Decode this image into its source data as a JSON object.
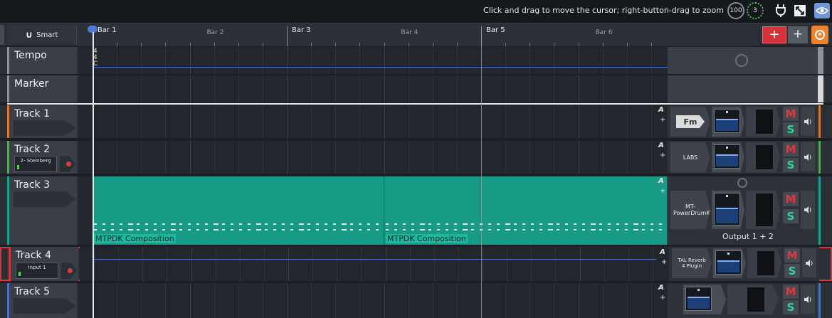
{
  "status": {
    "hint": "Click and drag to move the cursor; right-button-drag to zoom",
    "cpu_meter": "100",
    "dynamic_meter": "3",
    "icons": [
      "plug-icon",
      "fullscreen-icon",
      "eye-icon"
    ]
  },
  "toolbar": {
    "snap_label": "Smart",
    "add_track_label": "+",
    "add_label": "+"
  },
  "ruler": {
    "bars": [
      {
        "label": "Bar 1",
        "major": true
      },
      {
        "label": "Bar 2",
        "major": false
      },
      {
        "label": "Bar 3",
        "major": true
      },
      {
        "label": "Bar 4",
        "major": false
      },
      {
        "label": "Bar 5",
        "major": true
      },
      {
        "label": "Bar 6",
        "major": false
      }
    ]
  },
  "tempo": {
    "name": "Tempo",
    "time_sig_top": "4",
    "time_sig_bottom": "4",
    "key": "C"
  },
  "marker": {
    "name": "Marker"
  },
  "tracks": [
    {
      "name": "Track 1",
      "input": "",
      "plugin": "Fm",
      "accent": "#d9772e"
    },
    {
      "name": "Track 2",
      "input": "2- Steinberg",
      "plugin": "LABS",
      "accent": "#5aa55a"
    },
    {
      "name": "Track 3",
      "input": "",
      "plugin": "MT-PowerDrumKit",
      "accent": "#17a38c",
      "clips": [
        "MTPDK Composition",
        "MTPDK Composition"
      ],
      "output": "Output 1 + 2"
    },
    {
      "name": "Track 4",
      "input": "Input 1",
      "plugin": "TAL Reverb 4 Plugin",
      "accent": "#d9343b"
    },
    {
      "name": "Track 5",
      "input": "",
      "plugin": "",
      "accent": "#4a72c8"
    }
  ],
  "mixer": {
    "mute_label": "M",
    "solo_label": "S",
    "auto_label": "A",
    "auto_add_label": "+"
  }
}
